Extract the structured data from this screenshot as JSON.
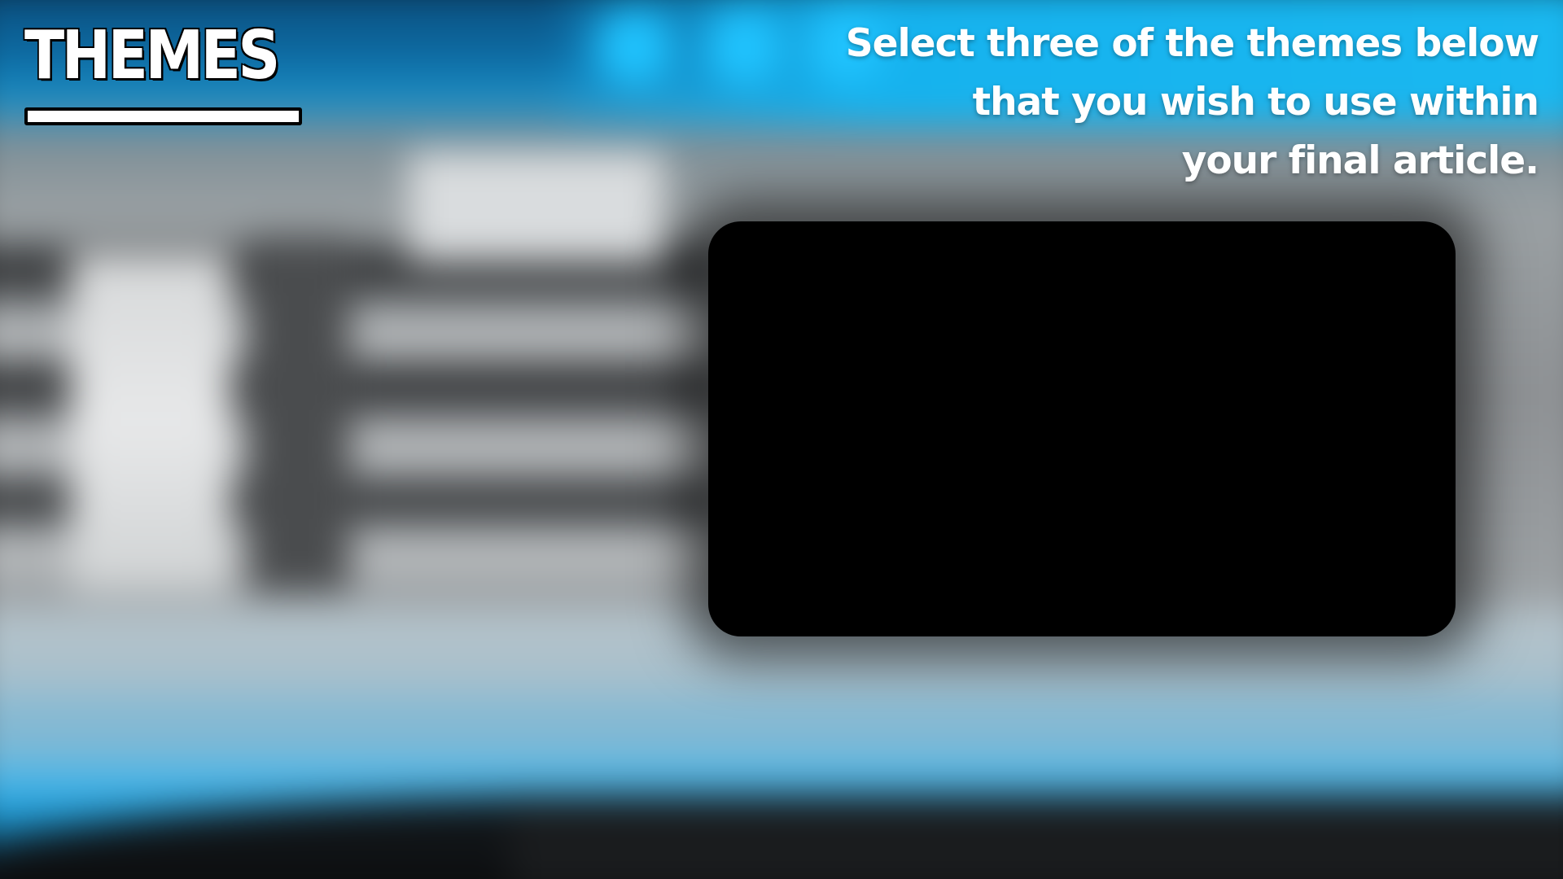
{
  "title": "THEMES",
  "instructions": {
    "line1": "Select three of the themes below",
    "line2": "that you wish to use within",
    "line3": "your final article."
  },
  "colors": {
    "accent": "#1ab8f0",
    "title_text": "#ffffff",
    "title_outline": "#000000",
    "screen": "#000000"
  }
}
